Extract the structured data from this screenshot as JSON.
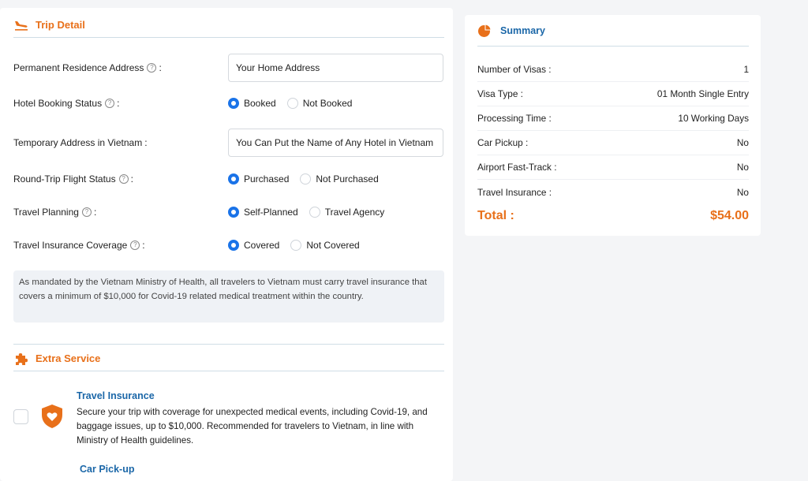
{
  "trip_detail": {
    "title": "Trip Detail",
    "icon": "plane-landing-icon",
    "permanent_address": {
      "label": "Permanent Residence Address",
      "colon": ":",
      "value": "Your Home Address"
    },
    "hotel_booking": {
      "label": "Hotel Booking Status",
      "colon": ":",
      "options": [
        "Booked",
        "Not Booked"
      ],
      "selected": "Booked"
    },
    "temporary_address": {
      "label": "Temporary Address in Vietnam",
      "colon": ":",
      "value": "You Can Put the Name of Any Hotel in Vietnam"
    },
    "flight_status": {
      "label": "Round-Trip Flight Status",
      "colon": ":",
      "options": [
        "Purchased",
        "Not Purchased"
      ],
      "selected": "Purchased"
    },
    "travel_planning": {
      "label": "Travel Planning",
      "colon": ":",
      "options": [
        "Self-Planned",
        "Travel Agency"
      ],
      "selected": "Self-Planned"
    },
    "insurance_coverage": {
      "label": "Travel Insurance Coverage",
      "colon": ":",
      "options": [
        "Covered",
        "Not Covered"
      ],
      "selected": "Covered"
    },
    "note": "As mandated by the Vietnam Ministry of Health, all travelers to Vietnam must carry travel insurance that covers a minimum of $10,000 for Covid-19 related medical treatment within the country."
  },
  "extra_service": {
    "title": "Extra Service",
    "icon": "puzzle-icon",
    "items": [
      {
        "title": "Travel Insurance",
        "icon": "shield-heart-icon",
        "description": "Secure your trip with coverage for unexpected medical events, including Covid-19, and baggage issues, up to $10,000. Recommended for travelers to Vietnam, in line with Ministry of Health guidelines."
      },
      {
        "title": "Car Pick-up"
      }
    ]
  },
  "summary": {
    "title": "Summary",
    "icon": "pie-chart-icon",
    "rows": [
      {
        "label": "Number of Visas :",
        "value": "1"
      },
      {
        "label": "Visa Type :",
        "value": "01 Month Single Entry"
      },
      {
        "label": "Processing Time :",
        "value": "10 Working Days"
      },
      {
        "label": "Car Pickup :",
        "value": "No"
      },
      {
        "label": "Airport Fast-Track :",
        "value": "No"
      },
      {
        "label": "Travel Insurance :",
        "value": "No"
      }
    ],
    "total_label": "Total :",
    "total_value": "$54.00"
  },
  "colors": {
    "accent": "#e8701a",
    "link": "#1b67a8",
    "radio": "#1a73e8"
  }
}
